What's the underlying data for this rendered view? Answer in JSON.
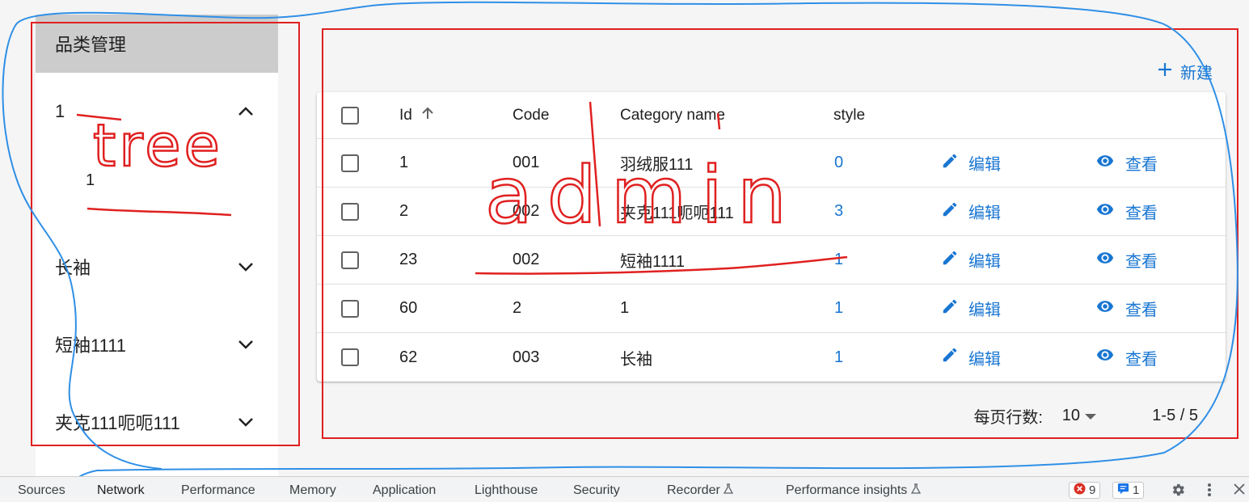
{
  "sidebar": {
    "title": "品类管理",
    "nodes": [
      {
        "label": "1",
        "expanded": true,
        "children": [
          "1"
        ]
      },
      {
        "label": "长袖",
        "expanded": false
      },
      {
        "label": "短袖1111",
        "expanded": false
      },
      {
        "label": "夹克111呃呃111",
        "expanded": false
      }
    ]
  },
  "toolbar": {
    "new_label": "新建"
  },
  "table": {
    "columns": [
      "Id",
      "Code",
      "Category name",
      "style"
    ],
    "sort_icon": "arrow-up-icon",
    "rows": [
      {
        "id": "1",
        "code": "001",
        "name": "羽绒服111",
        "style": "0",
        "edit": "编辑",
        "view": "查看"
      },
      {
        "id": "2",
        "code": "002",
        "name": "夹克111呃呃111",
        "style": "3",
        "edit": "编辑",
        "view": "查看"
      },
      {
        "id": "23",
        "code": "002",
        "name": "短袖1111",
        "style": "1",
        "edit": "编辑",
        "view": "查看"
      },
      {
        "id": "60",
        "code": "2",
        "name": "1",
        "style": "1",
        "edit": "编辑",
        "view": "查看"
      },
      {
        "id": "62",
        "code": "003",
        "name": "长袖",
        "style": "1",
        "edit": "编辑",
        "view": "查看"
      }
    ]
  },
  "pagination": {
    "rows_per_page_label": "每页行数:",
    "rows_per_page": "10",
    "range": "1-5 / 5"
  },
  "annotations": {
    "tree_label": "tree",
    "admin_label": "admin",
    "colors": {
      "box": "#e02020",
      "loop": "#2f8fe6"
    }
  },
  "devtools": {
    "tabs": [
      "Sources",
      "Network",
      "Performance",
      "Memory",
      "Application",
      "Lighthouse",
      "Security",
      "Recorder",
      "Performance insights"
    ],
    "active_tab": "Network",
    "errors": "9",
    "messages": "1"
  },
  "colors": {
    "accent": "#1976d2",
    "sidebar_header": "#cccccc"
  }
}
